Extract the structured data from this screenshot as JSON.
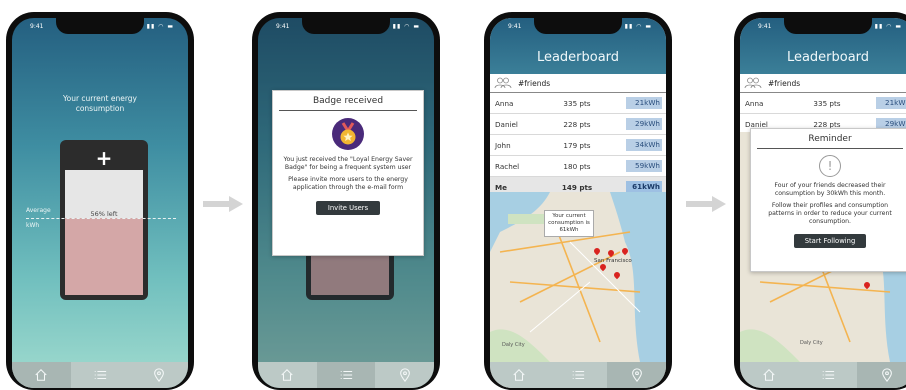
{
  "status": {
    "time": "9:41"
  },
  "screen1": {
    "title_line1": "Your current energy",
    "title_line2": "consumption",
    "battery_plus": "+",
    "battery_left": "56% left",
    "avg_line1": "Average",
    "avg_line2": "kWh"
  },
  "screen2": {
    "modal_title": "Badge received",
    "text1": "You just received the \"Loyal Energy Saver Badge\" for being a frequent system user",
    "text2": "Please invite more users to the energy application through the e-mail form",
    "button": "Invite Users"
  },
  "leaderboard": {
    "title": "Leaderboard",
    "group": "#friends",
    "rows": [
      {
        "name": "Anna",
        "points": "335 pts",
        "kwh": "21kWh"
      },
      {
        "name": "Daniel",
        "points": "228 pts",
        "kwh": "29kWh"
      },
      {
        "name": "John",
        "points": "179 pts",
        "kwh": "34kWh"
      },
      {
        "name": "Rachel",
        "points": "180 pts",
        "kwh": "59kWh"
      },
      {
        "name": "Me",
        "points": "149 pts",
        "kwh": "61kWh"
      }
    ],
    "map_callout": "Your current consumption is 61kWh",
    "map_city": "San Francisco",
    "map_label_daly": "Daly City"
  },
  "screen4": {
    "modal_title": "Reminder",
    "alert_symbol": "!",
    "text1": "Four of your friends decreased their consumption by 30kWh this month.",
    "text2": "Follow their profiles and consumption patterns in order to reduce your current consumption.",
    "button": "Start Following"
  },
  "colors": {
    "gradient_top": "#245f80",
    "gradient_bottom": "#a2dccf",
    "battery_pink": "#d4a7a7",
    "kwh_badge": "#b9cfe6",
    "tabbar": "#bcc9c6"
  },
  "icons": [
    "home-icon",
    "list-icon",
    "map-pin-icon",
    "medal-icon",
    "users-icon",
    "alert-icon",
    "arrow-right-icon"
  ]
}
